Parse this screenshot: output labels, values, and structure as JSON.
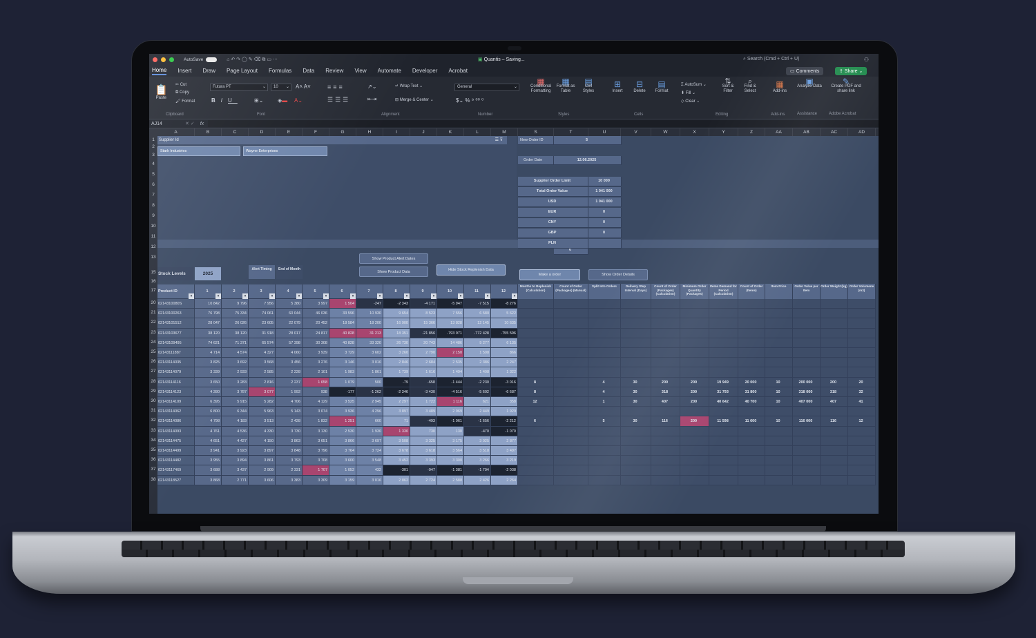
{
  "window": {
    "autosave": "AutoSave",
    "title": "Quantis",
    "status": "Saving...",
    "search_placeholder": "Search (Cmd + Ctrl + U)"
  },
  "tabs": [
    "Home",
    "Insert",
    "Draw",
    "Page Layout",
    "Formulas",
    "Data",
    "Review",
    "View",
    "Automate",
    "Developer",
    "Acrobat"
  ],
  "ribbon": {
    "comments": "Comments",
    "share": "Share",
    "clipboard": {
      "paste": "Paste",
      "cut": "Cut",
      "copy": "Copy",
      "format": "Format",
      "label": "Clipboard"
    },
    "font": {
      "family": "Futura PT",
      "size": "10",
      "label": "Font"
    },
    "alignment": {
      "wrap": "Wrap Text",
      "merge": "Merge & Center",
      "label": "Alignment"
    },
    "number": {
      "format": "General",
      "label": "Number"
    },
    "styles": {
      "cond": "Conditional Formatting",
      "table": "Format as Table",
      "cell": "Cell Styles",
      "label": "Styles"
    },
    "cells": {
      "insert": "Insert",
      "delete": "Delete",
      "format": "Format",
      "label": "Cells"
    },
    "editing": {
      "autosum": "AutoSum",
      "fill": "Fill",
      "clear": "Clear",
      "sort": "Sort & Filter",
      "find": "Find & Select",
      "label": "Editing"
    },
    "addins": {
      "addins": "Add-ins",
      "label": "Add-ins"
    },
    "assistance": {
      "analyze": "Analyze Data",
      "label": "Assistance"
    },
    "acrobat": {
      "create": "Create PDF and share link",
      "label": "Adobe Acrobat"
    }
  },
  "formula_bar": {
    "name_box": "AJ14",
    "fx": "fx"
  },
  "columns": [
    "A",
    "B",
    "C",
    "D",
    "E",
    "F",
    "G",
    "H",
    "I",
    "J",
    "K",
    "L",
    "M",
    "S",
    "T",
    "U",
    "V",
    "W",
    "X",
    "Y",
    "Z",
    "AA",
    "AB",
    "AC",
    "AD"
  ],
  "rows": [
    "1",
    "2",
    "3",
    "4",
    "5",
    "6",
    "7",
    "8",
    "9",
    "10",
    "11",
    "12",
    "13",
    "15",
    "16",
    "17",
    "20",
    "21",
    "22",
    "23",
    "24",
    "25",
    "26",
    "27",
    "28",
    "29",
    "30",
    "31",
    "32",
    "33",
    "34",
    "35",
    "36",
    "37",
    "38"
  ],
  "slicer": {
    "title": "Supplier Id",
    "items": [
      "Stark Industries",
      "Wayne Enterprises"
    ]
  },
  "order_panel": {
    "new_order_label": "New Order ID",
    "new_order_value": "5",
    "order_date_label": "Order Date",
    "order_date_value": "12.06.2025",
    "lines": [
      {
        "label": "Supplier Order Limit",
        "value": "10 000"
      },
      {
        "label": "Total Order Value",
        "value": "1 041 000"
      },
      {
        "label": "USD",
        "value": "1 041 000"
      },
      {
        "label": "EUR",
        "value": "0"
      },
      {
        "label": "CNY",
        "value": "0"
      },
      {
        "label": "GBP",
        "value": "0"
      },
      {
        "label": "PLN",
        "value": ""
      }
    ],
    "total": "0"
  },
  "buttons": {
    "alert_dates": "Show Product Alert Dates",
    "product_data": "Show Product Data",
    "hide_replenish": "Hide Stock Replenish Data",
    "make_order": "Make a order",
    "order_details": "Show Order Details"
  },
  "stock": {
    "title": "Stock Levels",
    "year": "2025",
    "alert_timing": "Alert Timing",
    "end_of_month": "End of Month",
    "product_id": "Product ID",
    "months": [
      "1",
      "2",
      "3",
      "4",
      "5",
      "6",
      "7",
      "8",
      "9",
      "10",
      "11",
      "12"
    ]
  },
  "right_headers": [
    "Months to Replenish (Calculation)",
    "Count of Order (Packages) (Manual)",
    "Split Into Orders",
    "Delivery Step Interval (Days)",
    "Count of Order (Packages) (Calculation)",
    "Minimum Order Quantity (Packages)",
    "Items Demand for Period (Calculation)",
    "Count of Order (Items)",
    "Item Price",
    "Order Value per Item",
    "Order Weight (kg)",
    "Order Volumene (m3)"
  ],
  "products": [
    {
      "id": "0214310080S",
      "v": [
        "10 842",
        "9 796",
        "7 956",
        "5 380",
        "3 997",
        "1 504",
        "-247",
        "-2 343",
        "-4 171",
        "-5 947",
        "-7 515",
        "-8 276"
      ],
      "r": [
        "",
        "",
        "",
        "",
        "",
        "",
        "",
        "",
        "",
        "",
        "",
        ""
      ]
    },
    {
      "id": "02143100263",
      "v": [
        "76 798",
        "75 334",
        "74 061",
        "60 044",
        "46 036",
        "33 596",
        "10 930",
        "9 654",
        "8 523",
        "7 556",
        "6 580",
        "5 622"
      ],
      "r": [
        "",
        "",
        "",
        "",
        "",
        "",
        "",
        "",
        "",
        "",
        "",
        ""
      ]
    },
    {
      "id": "02143101512",
      "v": [
        "28 047",
        "26 026",
        "23 605",
        "22 079",
        "20 452",
        "18 584",
        "18 200",
        "16 900",
        "15 366",
        "13 828",
        "12 145",
        "10 635"
      ],
      "r": [
        "",
        "",
        "",
        "",
        "",
        "",
        "",
        "",
        "",
        "",
        "",
        ""
      ]
    },
    {
      "id": "02143103677",
      "v": [
        "38 120",
        "38 120",
        "31 918",
        "28 017",
        "24 817",
        "40 828",
        "31 213",
        "18 351",
        "-21 856",
        "-793 971",
        "-772 428",
        "-755 596"
      ],
      "r": [
        "",
        "",
        "",
        "",
        "",
        "",
        "",
        "",
        "",
        "",
        "",
        ""
      ]
    },
    {
      "id": "02143109495",
      "v": [
        "74 621",
        "71 371",
        "65 574",
        "57 398",
        "30 308",
        "40 828",
        "33 320",
        "26 730",
        "20 743",
        "14 486",
        "9 277",
        "6 135"
      ],
      "r": [
        "",
        "",
        "",
        "",
        "",
        "",
        "",
        "",
        "",
        "",
        "",
        ""
      ]
    },
    {
      "id": "02143111887",
      "v": [
        "4 714",
        "4 574",
        "4 327",
        "4 060",
        "3 939",
        "3 729",
        "3 602",
        "3 260",
        "2 790",
        "2 150",
        "1 508",
        "866"
      ],
      "r": [
        "",
        "",
        "",
        "",
        "",
        "",
        "",
        "",
        "",
        "",
        "",
        ""
      ]
    },
    {
      "id": "02143114035",
      "v": [
        "3 825",
        "3 692",
        "3 568",
        "3 456",
        "3 276",
        "3 146",
        "3 010",
        "2 846",
        "2 684",
        "2 535",
        "2 386",
        "2 247"
      ],
      "r": [
        "",
        "",
        "",
        "",
        "",
        "",
        "",
        "",
        "",
        "",
        "",
        ""
      ]
    },
    {
      "id": "02143114079",
      "v": [
        "3 339",
        "2 933",
        "2 585",
        "2 228",
        "2 101",
        "1 983",
        "1 861",
        "1 739",
        "1 616",
        "1 494",
        "1 408",
        "1 322"
      ],
      "r": [
        "",
        "",
        "",
        "",
        "",
        "",
        "",
        "",
        "",
        "",
        "",
        ""
      ]
    },
    {
      "id": "02143114116",
      "v": [
        "3 650",
        "3 283",
        "2 816",
        "2 237",
        "1 658",
        "1 079",
        "500",
        "-79",
        "-658",
        "-1 444",
        "-2 230",
        "-3 016"
      ],
      "r": [
        "8",
        "",
        "4",
        "30",
        "200",
        "200",
        "19 949",
        "20 000",
        "10",
        "200 000",
        "200",
        "20"
      ]
    },
    {
      "id": "02143114123",
      "v": [
        "4 280",
        "3 787",
        "3 077",
        "1 992",
        "938",
        "-177",
        "-1 262",
        "-2 346",
        "-3 430",
        "-4 516",
        "-5 602",
        "-6 687"
      ],
      "r": [
        "8",
        "",
        "4",
        "30",
        "318",
        "200",
        "31 793",
        "31 800",
        "10",
        "318 000",
        "318",
        "32"
      ]
    },
    {
      "id": "02143114109",
      "v": [
        "6 395",
        "5 915",
        "5 282",
        "4 706",
        "4 129",
        "3 525",
        "2 945",
        "2 297",
        "1 722",
        "1 116",
        "621",
        "358"
      ],
      "r": [
        "12",
        "",
        "1",
        "30",
        "407",
        "200",
        "40 642",
        "40 700",
        "10",
        "407 000",
        "407",
        "41"
      ]
    },
    {
      "id": "02143114062",
      "v": [
        "6 800",
        "6 344",
        "5 963",
        "5 143",
        "3 074",
        "3 936",
        "4 296",
        "3 897",
        "3 489",
        "2 969",
        "2 449",
        "1 929"
      ],
      "r": [
        "",
        "",
        "",
        "",
        "",
        "",
        "",
        "",
        "",
        "",
        "",
        ""
      ]
    },
    {
      "id": "02143114086",
      "v": [
        "4 798",
        "4 183",
        "3 513",
        "2 428",
        "1 832",
        "1 251",
        "660",
        "71",
        "-493",
        "-1 061",
        "-1 656",
        "-2 212"
      ],
      "r": [
        "6",
        "",
        "5",
        "30",
        "116",
        "200",
        "11 598",
        "11 600",
        "10",
        "116 000",
        "116",
        "12"
      ]
    },
    {
      "id": "02143114093",
      "v": [
        "4 761",
        "4 536",
        "4 330",
        "3 730",
        "3 130",
        "2 530",
        "1 930",
        "1 330",
        "730",
        "130",
        "-470",
        "-1 070"
      ],
      "r": [
        "",
        "",
        "",
        "",
        "",
        "",
        "",
        "",
        "",
        "",
        "",
        ""
      ]
    },
    {
      "id": "02143114475",
      "v": [
        "4 651",
        "4 427",
        "4 150",
        "3 863",
        "3 651",
        "3 866",
        "3 697",
        "3 508",
        "3 325",
        "3 175",
        "3 025",
        "2 877"
      ],
      "r": [
        "",
        "",
        "",
        "",
        "",
        "",
        "",
        "",
        "",
        "",
        "",
        ""
      ]
    },
    {
      "id": "02143114499",
      "v": [
        "3 941",
        "3 923",
        "3 897",
        "3 848",
        "3 796",
        "3 764",
        "3 724",
        "3 678",
        "3 618",
        "3 564",
        "3 518",
        "3 497"
      ],
      "r": [
        "",
        "",
        "",
        "",
        "",
        "",
        "",
        "",
        "",
        "",
        "",
        ""
      ]
    },
    {
      "id": "02143114482",
      "v": [
        "3 955",
        "3 894",
        "3 861",
        "3 793",
        "3 708",
        "3 600",
        "3 548",
        "3 452",
        "3 393",
        "3 300",
        "3 266",
        "3 219"
      ],
      "r": [
        "",
        "",
        "",
        "",
        "",
        "",
        "",
        "",
        "",
        "",
        "",
        ""
      ]
    },
    {
      "id": "02143117469",
      "v": [
        "3 688",
        "3 437",
        "2 909",
        "2 331",
        "1 707",
        "1 052",
        "432",
        "-301",
        "-947",
        "-1 381",
        "-1 794",
        "-2 038"
      ],
      "r": [
        "",
        "",
        "",
        "",
        "",
        "",
        "",
        "",
        "",
        "",
        "",
        ""
      ]
    },
    {
      "id": "02143118527",
      "v": [
        "3 868",
        "2 771",
        "3 606",
        "3 383",
        "3 309",
        "3 159",
        "3 016",
        "2 862",
        "2 724",
        "2 588",
        "2 426",
        "2 264"
      ],
      "r": [
        "",
        "",
        "",
        "",
        "",
        "",
        "",
        "",
        "",
        "",
        "",
        ""
      ]
    }
  ],
  "colors": {
    "pink": "#a8456f",
    "dark": "#1c2330",
    "lightblue": "#8ea2c6",
    "sheet": "#3b4a63",
    "green": "#1f8a4c"
  }
}
